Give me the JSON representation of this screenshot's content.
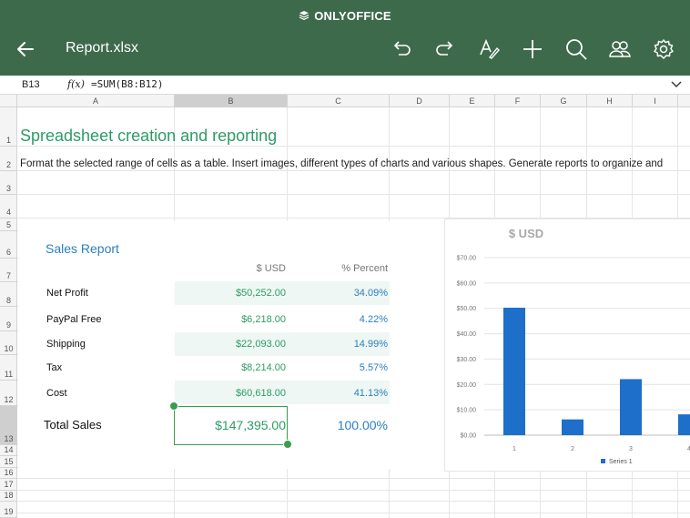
{
  "app": {
    "brand": "ONLYOFFICE",
    "title": "Report.xlsx"
  },
  "colors": {
    "header_bg": "#3e6a4c",
    "title_green": "#2e9b67",
    "accent_blue": "#2a7fc1",
    "band": "#eef7f3",
    "bar": "#1e6fc9"
  },
  "toolbar": {
    "icons": [
      "undo-icon",
      "redo-icon",
      "text-format-icon",
      "add-icon",
      "search-icon",
      "users-icon",
      "settings-icon"
    ]
  },
  "formula_bar": {
    "cell_ref": "B13",
    "fx_label": "f(x)",
    "formula": "=SUM(B8:B12)"
  },
  "columns": [
    "A",
    "B",
    "C",
    "D",
    "E",
    "F",
    "G",
    "H",
    "I"
  ],
  "rows": [
    "1",
    "2",
    "3",
    "4",
    "5",
    "6",
    "7",
    "8",
    "9",
    "10",
    "11",
    "12",
    "13",
    "14",
    "15",
    "16",
    "17",
    "18",
    "19"
  ],
  "sheet": {
    "title": "Spreadsheet creation and reporting",
    "description": "Format the selected range of cells as a table. Insert images, different types of charts and various shapes. Generate reports to organize and"
  },
  "report": {
    "title": "Sales Report",
    "header_usd": "$ USD",
    "header_pct": "% Percent",
    "items": [
      {
        "label": "Net Profit",
        "usd": "$50,252.00",
        "pct": "34.09%"
      },
      {
        "label": "PayPal Free",
        "usd": "$6,218.00",
        "pct": "4.22%"
      },
      {
        "label": "Shipping",
        "usd": "$22,093.00",
        "pct": "14.99%"
      },
      {
        "label": "Tax",
        "usd": "$8,214.00",
        "pct": "5.57%"
      },
      {
        "label": "Cost",
        "usd": "$60,618.00",
        "pct": "41.13%"
      }
    ],
    "total": {
      "label": "Total Sales",
      "usd": "$147,395.00",
      "pct": "100.00%"
    }
  },
  "chart_data": {
    "type": "bar",
    "title": "$ USD",
    "categories": [
      "1",
      "2",
      "3",
      "4"
    ],
    "series": [
      {
        "name": "Series 1",
        "values": [
          50.25,
          6.22,
          22.09,
          8.21
        ]
      }
    ],
    "y_ticks": [
      "$0.00",
      "$10.00",
      "$20.00",
      "$30.00",
      "$40.00",
      "$50.00",
      "$60.00",
      "$70.00"
    ],
    "ylim": [
      0,
      70
    ],
    "grid": true,
    "legend": "bottom"
  }
}
